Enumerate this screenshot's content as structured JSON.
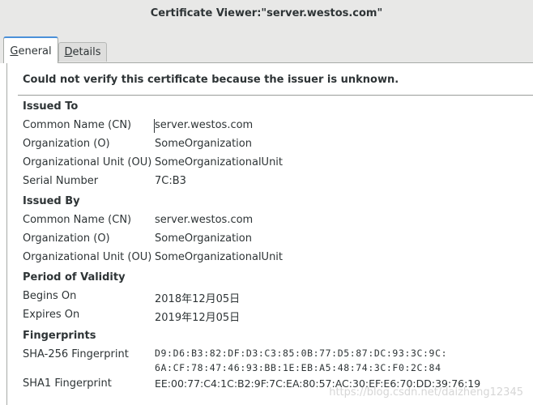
{
  "window": {
    "title": "Certificate Viewer:\"server.westos.com\""
  },
  "tabs": {
    "general": "General",
    "details": "Details"
  },
  "warning": "Could not verify this certificate because the issuer is unknown.",
  "issued_to": {
    "heading": "Issued To",
    "rows": [
      {
        "label": "Common Name (CN)",
        "value": "server.westos.com"
      },
      {
        "label": "Organization (O)",
        "value": "SomeOrganization"
      },
      {
        "label": "Organizational Unit (OU)",
        "value": "SomeOrganizationalUnit"
      },
      {
        "label": "Serial Number",
        "value": "7C:B3"
      }
    ]
  },
  "issued_by": {
    "heading": "Issued By",
    "rows": [
      {
        "label": "Common Name (CN)",
        "value": "server.westos.com"
      },
      {
        "label": "Organization (O)",
        "value": "SomeOrganization"
      },
      {
        "label": "Organizational Unit (OU)",
        "value": "SomeOrganizationalUnit"
      }
    ]
  },
  "validity": {
    "heading": "Period of Validity",
    "rows": [
      {
        "label": "Begins On",
        "value": "2018年12月05日"
      },
      {
        "label": "Expires On",
        "value": "2019年12月05日"
      }
    ]
  },
  "fingerprints": {
    "heading": "Fingerprints",
    "sha256": {
      "label": "SHA-256 Fingerprint",
      "line1": "D9:D6:B3:82:DF:D3:C3:85:0B:77:D5:87:DC:93:3C:9C:",
      "line2": "6A:CF:78:47:46:93:BB:1E:EB:A5:48:74:3C:F0:2C:84"
    },
    "sha1": {
      "label": "SHA1 Fingerprint",
      "value": "EE:00:77:C4:1C:B2:9F:7C:EA:80:57:AC:30:EF:E6:70:DD:39:76:19"
    }
  },
  "watermark": "https://blog.csdn.net/daizheng12345",
  "colors": {
    "titlebar_bg": "#e8e8e7",
    "accent": "#4a90d9",
    "text": "#2e3436"
  }
}
